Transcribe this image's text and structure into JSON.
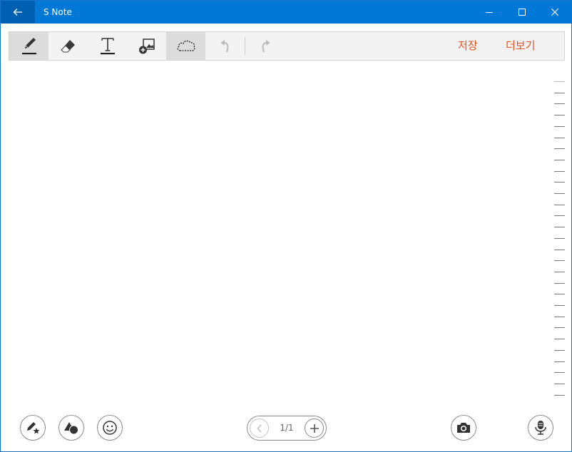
{
  "window": {
    "title": "S Note",
    "accent_color": "#0078d7",
    "back_icon": "back-arrow-icon",
    "controls": [
      "minimize-icon",
      "maximize-icon",
      "close-icon"
    ]
  },
  "toolbar": {
    "tools": [
      {
        "name": "pen",
        "icon": "pen-icon",
        "active": true
      },
      {
        "name": "eraser",
        "icon": "eraser-icon",
        "active": false
      },
      {
        "name": "text",
        "icon": "text-icon",
        "active": false
      },
      {
        "name": "image",
        "icon": "insert-image-icon",
        "active": false
      },
      {
        "name": "lasso",
        "icon": "lasso-select-icon",
        "active": true
      },
      {
        "name": "undo",
        "icon": "undo-icon",
        "enabled": false
      },
      {
        "name": "redo",
        "icon": "redo-icon",
        "enabled": false
      }
    ],
    "save_label": "저장",
    "more_label": "더보기",
    "link_color": "#e8501f"
  },
  "bottom_bar": {
    "left_buttons": [
      "pen-favorites-icon",
      "shape-icon",
      "emoji-icon"
    ],
    "page_indicator": "1/1",
    "right_buttons": [
      "camera-icon",
      "microphone-icon"
    ]
  }
}
